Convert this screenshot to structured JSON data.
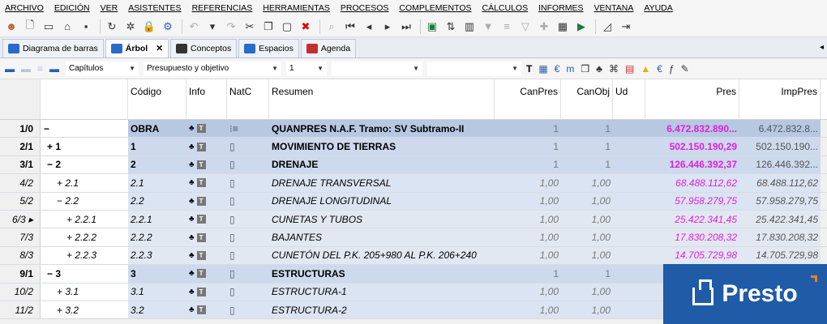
{
  "menu": [
    "ARCHIVO",
    "EDICIÓN",
    "VER",
    "ASISTENTES",
    "REFERENCIAS",
    "HERRAMIENTAS",
    "PROCESOS",
    "COMPLEMENTOS",
    "CÁLCULOS",
    "INFORMES",
    "VENTANA",
    "AYUDA"
  ],
  "tabs": [
    {
      "label": "Diagrama de barras",
      "icon": "bar-chart-icon",
      "color": "#2a6ac8"
    },
    {
      "label": "Árbol",
      "icon": "tree-icon",
      "color": "#2a6ac8",
      "active": true
    },
    {
      "label": "Conceptos",
      "icon": "list-icon",
      "color": "#333333"
    },
    {
      "label": "Espacios",
      "icon": "spaces-icon",
      "color": "#2a6ac8"
    },
    {
      "label": "Agenda",
      "icon": "calendar-icon",
      "color": "#c03030"
    }
  ],
  "filter": {
    "capitulos": "Capítulos",
    "presupuesto": "Presupuesto y objetivo",
    "nivel": "1"
  },
  "columns": {
    "codigo": "Código",
    "info": "Info",
    "natc": "NatC",
    "resumen": "Resumen",
    "canpres": "CanPres",
    "canobj": "CanObj",
    "ud": "Ud",
    "pres": "Pres",
    "imppres": "ImpPres"
  },
  "rows": [
    {
      "num": "1/0",
      "tree": "−",
      "codigo": "OBRA",
      "resumen": "QUANPRES N.A.F. Tramo: SV Subtramo-II",
      "canpres": "1",
      "canobj": "1",
      "pres": "6.472.832.890...",
      "imppres": "6.472.832.8..."
    },
    {
      "num": "2/1",
      "tree": "+ 1",
      "codigo": "1",
      "resumen": "MOVIMIENTO DE TIERRAS",
      "canpres": "1",
      "canobj": "1",
      "pres": "502.150.190,29",
      "imppres": "502.150.190..."
    },
    {
      "num": "3/1",
      "tree": "− 2",
      "codigo": "2",
      "resumen": "DRENAJE",
      "canpres": "1",
      "canobj": "1",
      "pres": "126.446.392,37",
      "imppres": "126.446.392..."
    },
    {
      "num": "4/2",
      "tree": "+ 2.1",
      "codigo": "2.1",
      "resumen": "DRENAJE TRANSVERSAL",
      "canpres": "1,00",
      "canobj": "1,00",
      "pres": "68.488.112,62",
      "imppres": "68.488.112,62"
    },
    {
      "num": "5/2",
      "tree": "− 2.2",
      "codigo": "2.2",
      "resumen": "DRENAJE LONGITUDINAL",
      "canpres": "1,00",
      "canobj": "1,00",
      "pres": "57.958.279,75",
      "imppres": "57.958.279,75"
    },
    {
      "num": "6/3 ▸",
      "tree": "+ 2.2.1",
      "codigo": "2.2.1",
      "resumen": "CUNETAS Y TUBOS",
      "canpres": "1,00",
      "canobj": "1,00",
      "pres": "25.422.341,45",
      "imppres": "25.422.341,45"
    },
    {
      "num": "7/3",
      "tree": "+ 2.2.2",
      "codigo": "2.2.2",
      "resumen": "BAJANTES",
      "canpres": "1,00",
      "canobj": "1,00",
      "pres": "17.830.208,32",
      "imppres": "17.830.208,32"
    },
    {
      "num": "8/3",
      "tree": "+ 2.2.3",
      "codigo": "2.2.3",
      "resumen": "CUNETÓN DEL P.K. 205+980 AL P.K. 206+240",
      "canpres": "1,00",
      "canobj": "1,00",
      "pres": "14.705.729,98",
      "imppres": "14.705.729,98"
    },
    {
      "num": "9/1",
      "tree": "− 3",
      "codigo": "3",
      "resumen": "ESTRUCTURAS",
      "canpres": "1",
      "canobj": "1",
      "pres": "",
      "imppres": ""
    },
    {
      "num": "10/2",
      "tree": "+ 3.1",
      "codigo": "3.1",
      "resumen": "ESTRUCTURA-1",
      "canpres": "1,00",
      "canobj": "1,00",
      "pres": "",
      "imppres": ""
    },
    {
      "num": "11/2",
      "tree": "+ 3.2",
      "codigo": "3.2",
      "resumen": "ESTRUCTURA-2",
      "canpres": "1,00",
      "canobj": "1,00",
      "pres": "",
      "imppres": ""
    }
  ],
  "logo": {
    "text": "Presto"
  }
}
